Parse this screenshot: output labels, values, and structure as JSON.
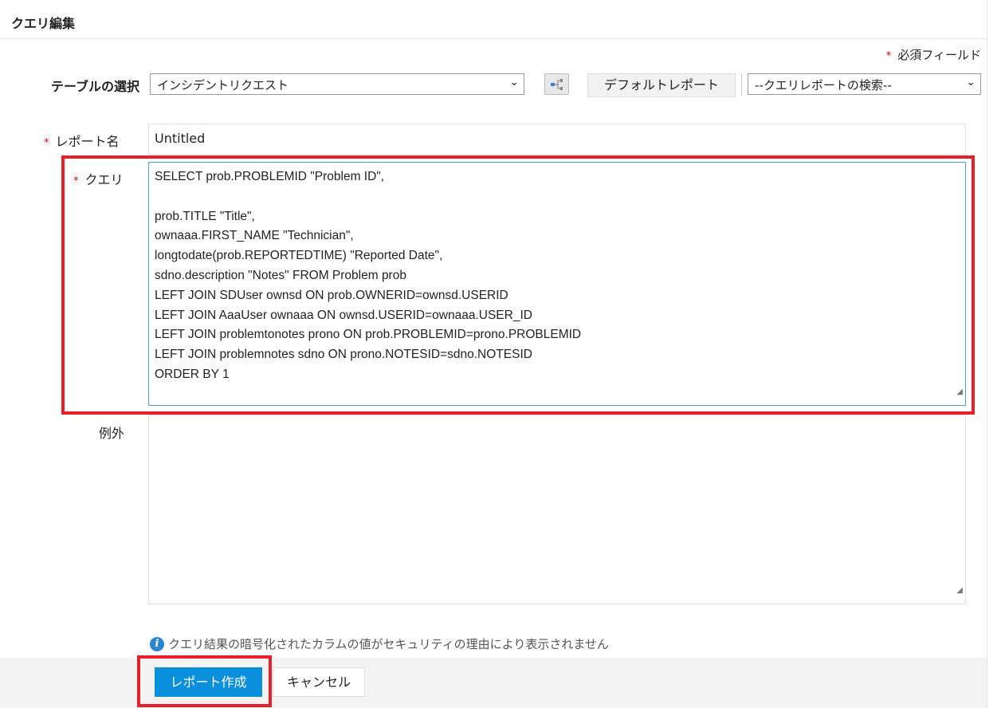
{
  "header": {
    "title": "クエリ編集"
  },
  "required_note": "必須フィールド",
  "table_select": {
    "label": "テーブルの選択",
    "value": "インシデントリクエスト"
  },
  "default_report_button": "デフォルトレポート",
  "query_report_search": {
    "value": "--クエリレポートの検索--"
  },
  "report_name": {
    "label": "レポート名",
    "value": "Untitled"
  },
  "query": {
    "label": "クエリ",
    "value": "SELECT prob.PROBLEMID \"Problem ID\",\n\nprob.TITLE \"Title\",\nownaaa.FIRST_NAME \"Technician\",\nlongtodate(prob.REPORTEDTIME) \"Reported Date\",\nsdno.description \"Notes\" FROM Problem prob\nLEFT JOIN SDUser ownsd ON prob.OWNERID=ownsd.USERID\nLEFT JOIN AaaUser ownaaa ON ownsd.USERID=ownaaa.USER_ID\nLEFT JOIN problemtonotes prono ON prob.PROBLEMID=prono.PROBLEMID\nLEFT JOIN problemnotes sdno ON prono.NOTESID=sdno.NOTESID\nORDER BY 1"
  },
  "exceptions": {
    "label": "例外",
    "value": ""
  },
  "info_note": "クエリ結果の暗号化されたカラムの値がセキュリティの理由により表示されません",
  "buttons": {
    "create": "レポート作成",
    "cancel": "キャンセル"
  },
  "colors": {
    "primary": "#0a8fdc",
    "highlight": "#e8202a"
  }
}
